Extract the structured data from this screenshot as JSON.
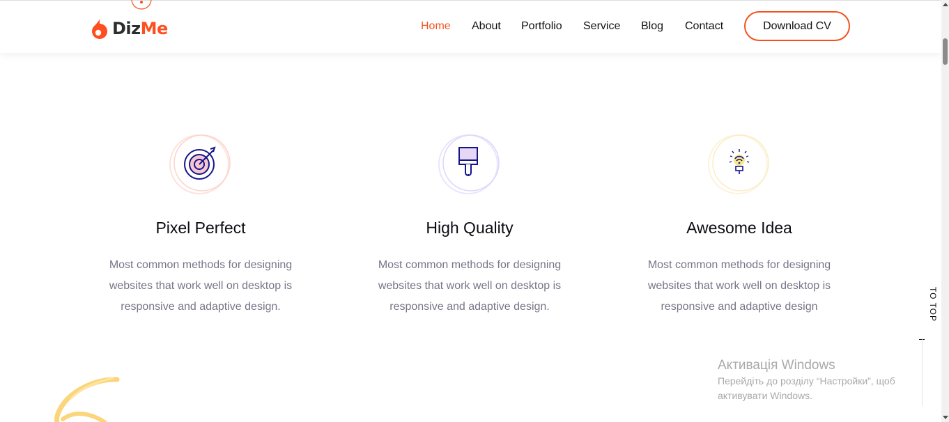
{
  "header": {
    "logo": {
      "text_main": "Diz",
      "text_accent": "Me",
      "icon": "flame-drop-icon"
    },
    "nav": [
      {
        "label": "Home",
        "active": true
      },
      {
        "label": "About",
        "active": false
      },
      {
        "label": "Portfolio",
        "active": false
      },
      {
        "label": "Service",
        "active": false
      },
      {
        "label": "Blog",
        "active": false
      },
      {
        "label": "Contact",
        "active": false
      }
    ],
    "cv_button": "Download CV"
  },
  "services": [
    {
      "icon": "target-icon",
      "title": "Pixel Perfect",
      "description": "Most common methods for designing websites that work well on desktop is responsive and adaptive design."
    },
    {
      "icon": "paint-brush-icon",
      "title": "High Quality",
      "description": "Most common methods for designing websites that work well on desktop is responsive and adaptive design."
    },
    {
      "icon": "light-bulb-icon",
      "title": "Awesome Idea",
      "description": "Most common methods for designing websites that work well on desktop is responsive and adaptive design"
    }
  ],
  "to_top": "TO TOP",
  "activation": {
    "title": "Активація Windows",
    "line1": "Перейдіть до розділу “Настройки”, щоб",
    "line2": "активувати Windows."
  },
  "colors": {
    "accent": "#f4511e",
    "text_dark": "#0b0b13",
    "text_muted": "#767588",
    "ring_red": "#fbd3cc",
    "ring_purple": "#dcd6fb",
    "ring_yellow": "#fcecc4",
    "icon_navy": "#14148c"
  }
}
